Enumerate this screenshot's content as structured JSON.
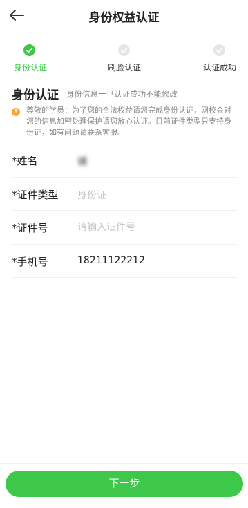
{
  "header": {
    "title": "身份权益认证",
    "back_icon": "arrow-left-icon"
  },
  "steps": [
    {
      "label": "身份认证",
      "state": "done",
      "color": "#3ec84a"
    },
    {
      "label": "刷脸认证",
      "state": "pending",
      "color": "#e5e5e5"
    },
    {
      "label": "认证成功",
      "state": "pending",
      "color": "#e5e5e5"
    }
  ],
  "section": {
    "title": "身份认证",
    "subtitle": "身份信息一旦认证成功不能修改",
    "notice": "尊敬的学员：为了您的合法权益请您完成身份认证，网校会对您的信息加密处理保护请您放心认证。目前证件类型只支持身份证，如有问题请联系客服。",
    "notice_icon": "info-icon",
    "notice_icon_color": "#f7a335"
  },
  "form": {
    "name": {
      "label": "*姓名",
      "value": "诚"
    },
    "id_type": {
      "label": "*证件类型",
      "placeholder": "身份证"
    },
    "id_number": {
      "label": "*证件号",
      "placeholder": "请输入证件号",
      "value": ""
    },
    "phone": {
      "label": "*手机号",
      "value": "18211122212"
    }
  },
  "footer": {
    "next_label": "下一步",
    "button_color": "#3ec84a"
  }
}
